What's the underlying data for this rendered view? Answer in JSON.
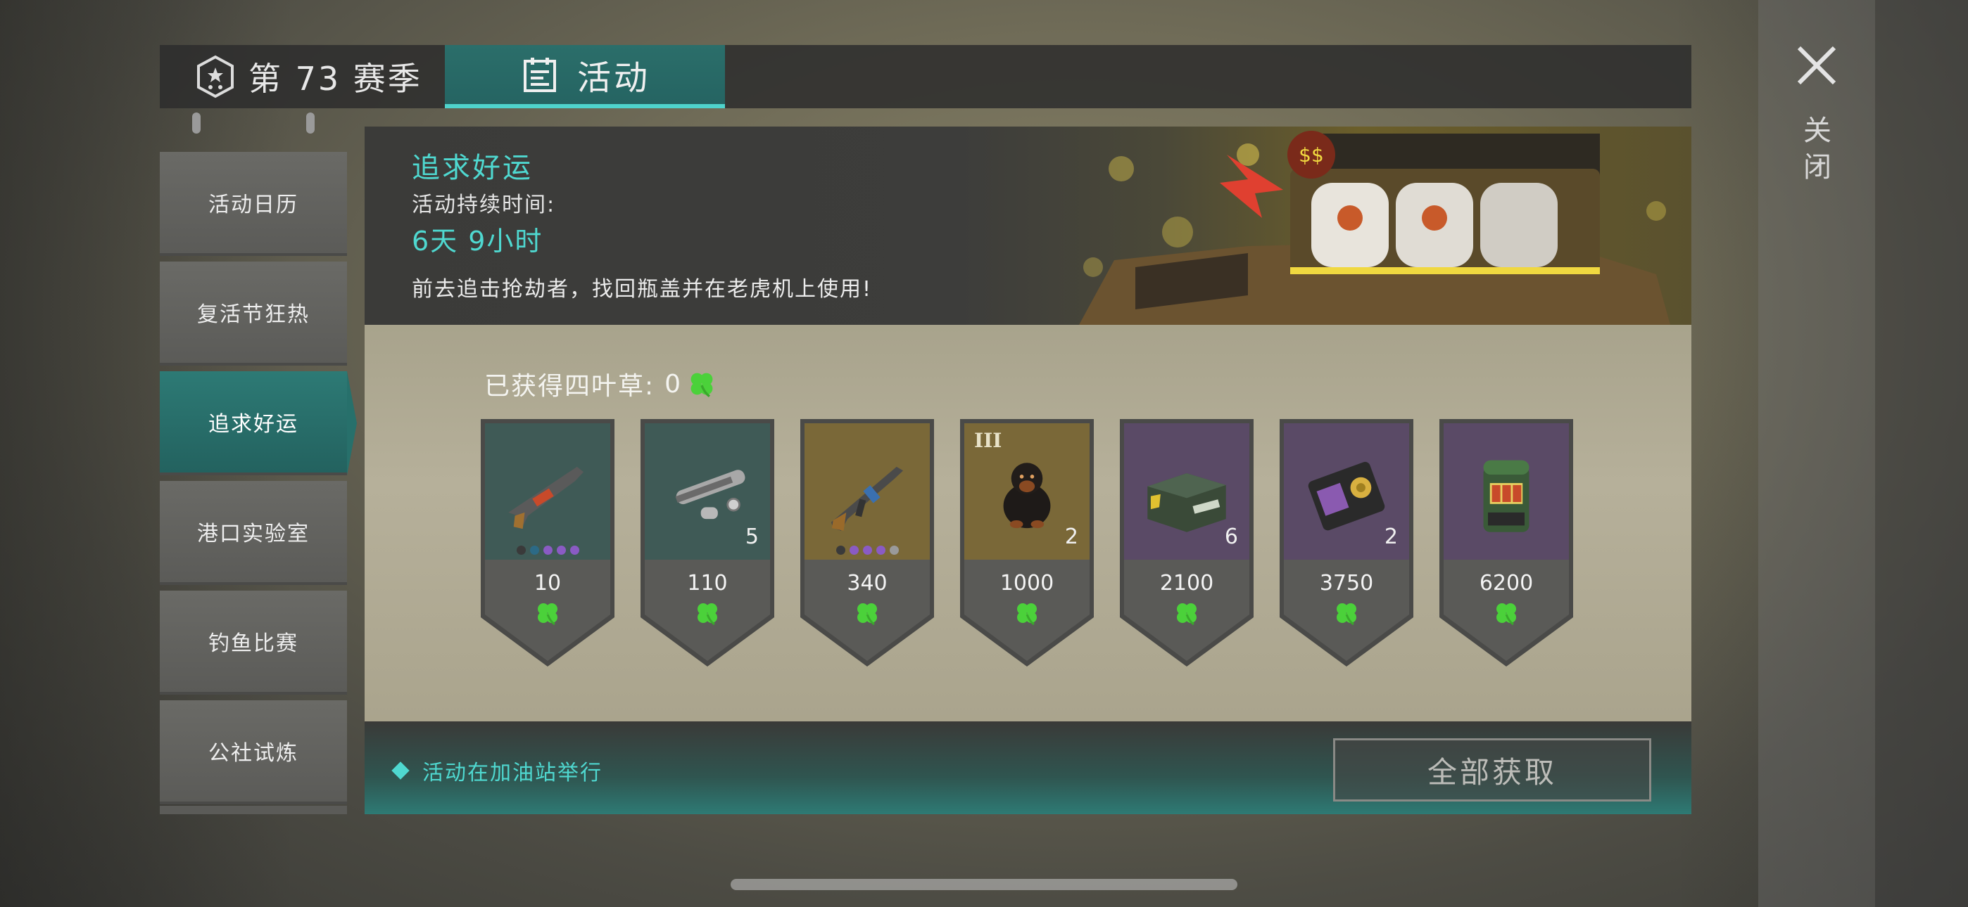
{
  "header": {
    "season_tab": "第 73 赛季",
    "activity_tab": "活动",
    "close_label": "关闭"
  },
  "sidebar": {
    "items": [
      {
        "label": "活动日历",
        "active": false
      },
      {
        "label": "复活节狂热",
        "active": false
      },
      {
        "label": "追求好运",
        "active": true
      },
      {
        "label": "港口实验室",
        "active": false
      },
      {
        "label": "钓鱼比赛",
        "active": false
      },
      {
        "label": "公社试炼",
        "active": false
      }
    ]
  },
  "banner": {
    "title": "追求好运",
    "duration_label": "活动持续时间:",
    "duration": "6天 9小时",
    "description": "前去追击抢劫者，找回瓶盖并在老虎机上使用!"
  },
  "progress": {
    "label": "已获得四叶草:",
    "count": "0"
  },
  "rewards": [
    {
      "icon": "shotgun-icon",
      "cost": "10",
      "qty": "",
      "tier": "",
      "bg": "#3f5a56",
      "dots": [
        "#3a3a3a",
        "#2c6a86",
        "#8a5bc4",
        "#8a5bc4",
        "#8a5bc4"
      ]
    },
    {
      "icon": "silencer-parts-icon",
      "cost": "110",
      "qty": "5",
      "tier": "",
      "bg": "#3f5a56",
      "dots": []
    },
    {
      "icon": "assault-rifle-icon",
      "cost": "340",
      "qty": "",
      "tier": "",
      "bg": "#7a6838",
      "dots": [
        "#3a3a3a",
        "#8a5bc4",
        "#8a5bc4",
        "#8a5bc4",
        "#9a9a9a"
      ]
    },
    {
      "icon": "rottweiler-dog-icon",
      "cost": "1000",
      "qty": "2",
      "tier": "III",
      "bg": "#7a6838",
      "dots": []
    },
    {
      "icon": "weapon-crate-icon",
      "cost": "2100",
      "qty": "6",
      "tier": "",
      "bg": "#5a4a66",
      "dots": []
    },
    {
      "icon": "police-badge-icon",
      "cost": "3750",
      "qty": "2",
      "tier": "",
      "bg": "#5a4a66",
      "dots": []
    },
    {
      "icon": "slot-machine-icon",
      "cost": "6200",
      "qty": "",
      "tier": "",
      "bg": "#5a4a66",
      "dots": []
    }
  ],
  "footer": {
    "location": "活动在加油站举行",
    "claim_all": "全部获取"
  },
  "colors": {
    "accent": "#4fd8d0",
    "clover": "#4bd13a",
    "tab_active": "#2b6e6a"
  }
}
